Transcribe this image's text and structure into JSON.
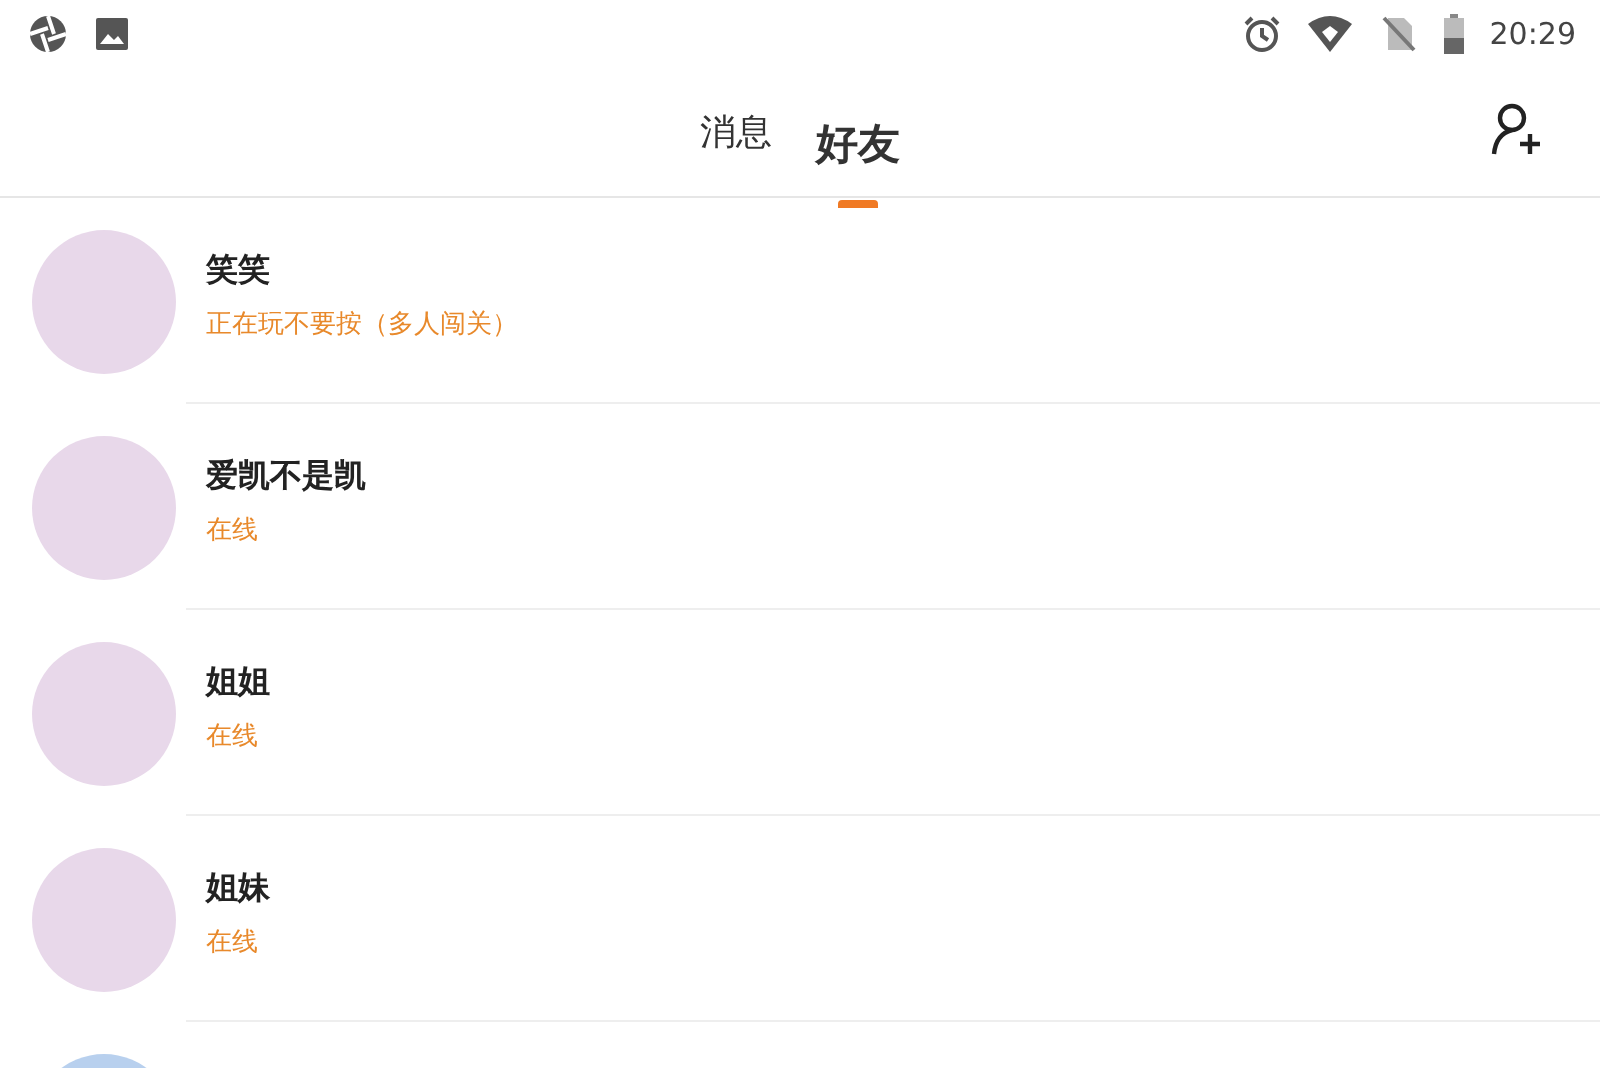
{
  "status_bar": {
    "time": "20:29"
  },
  "tabs": [
    {
      "label": "消息",
      "selected": false
    },
    {
      "label": "好友",
      "selected": true
    }
  ],
  "friends": [
    {
      "name": "笑笑",
      "status": "正在玩不要按（多人闯关）"
    },
    {
      "name": "爱凯不是凯",
      "status": "在线"
    },
    {
      "name": "姐姐",
      "status": "在线"
    },
    {
      "name": "姐妹",
      "status": "在线"
    }
  ],
  "more_below": true
}
